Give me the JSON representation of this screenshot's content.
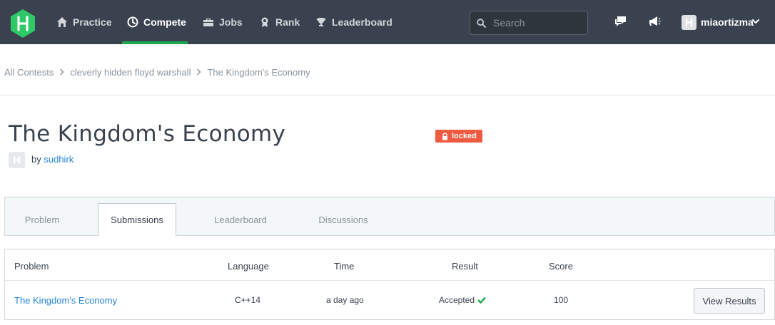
{
  "nav": {
    "items": [
      {
        "label": "Practice",
        "icon": "home-icon"
      },
      {
        "label": "Compete",
        "icon": "clock-icon",
        "active": true
      },
      {
        "label": "Jobs",
        "icon": "briefcase-icon"
      },
      {
        "label": "Rank",
        "icon": "rank-medal-icon"
      },
      {
        "label": "Leaderboard",
        "icon": "trophy-icon"
      }
    ],
    "search_placeholder": "Search",
    "username": "miaortizma",
    "accent_color": "#1ba94c"
  },
  "breadcrumb": [
    "All Contests",
    "cleverly hidden floyd warshall",
    "The Kingdom's Economy"
  ],
  "challenge": {
    "title": "The Kingdom's Economy",
    "status_badge": "locked",
    "by_label": "by",
    "author": "sudhirk"
  },
  "tabs": [
    "Problem",
    "Submissions",
    "Leaderboard",
    "Discussions"
  ],
  "active_tab": "Submissions",
  "table": {
    "headers": [
      "Problem",
      "Language",
      "Time",
      "Result",
      "Score"
    ],
    "rows": [
      {
        "problem": "The Kingdom's Economy",
        "language": "C++14",
        "time": "a day ago",
        "result": "Accepted",
        "score": "100",
        "action": "View Results"
      }
    ]
  }
}
